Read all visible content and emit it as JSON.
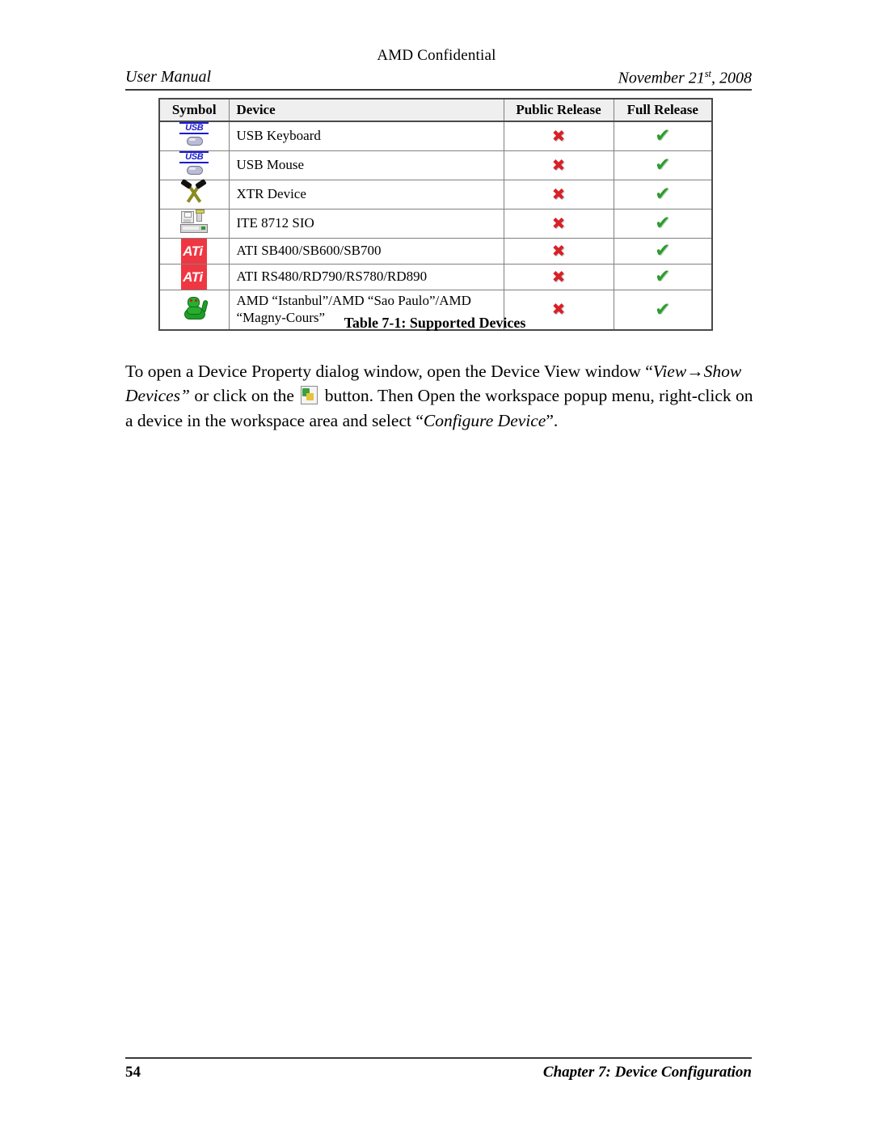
{
  "header": {
    "confidential": "AMD Confidential",
    "left": "User Manual",
    "date_prefix": "November 21",
    "date_suffix": "st",
    "date_year": ", 2008"
  },
  "table": {
    "columns": [
      "Symbol",
      "Device",
      "Public Release",
      "Full Release"
    ],
    "rows": [
      {
        "symbol": "usb-keyboard-icon",
        "device": "USB Keyboard",
        "public_release": "✖",
        "full_release": "✔"
      },
      {
        "symbol": "usb-mouse-icon",
        "device": "USB Mouse",
        "public_release": "✖",
        "full_release": "✔"
      },
      {
        "symbol": "crossed-hammers-icon",
        "device": "XTR Device",
        "public_release": "✖",
        "full_release": "✔"
      },
      {
        "symbol": "sio-chip-icon",
        "device": "ITE 8712 SIO",
        "public_release": "✖",
        "full_release": "✔"
      },
      {
        "symbol": "ati-logo-icon",
        "device": "ATI SB400/SB600/SB700",
        "public_release": "✖",
        "full_release": "✔"
      },
      {
        "symbol": "ati-logo-icon",
        "device": "ATI RS480/RD790/RS780/RD890",
        "public_release": "✖",
        "full_release": "✔"
      },
      {
        "symbol": "snake-icon",
        "device": "AMD “Istanbul”/AMD “Sao Paulo”/AMD “Magny-Cours”",
        "public_release": "✖",
        "full_release": "✔"
      }
    ],
    "ati_logo_text": "ATi",
    "usb_word": "USB",
    "caption": "Table 7-1: Supported Devices"
  },
  "body": {
    "part1": "To open a Device Property dialog window, open the Device View window “",
    "emph1": "View→Show Devices”",
    "part2": " or click on the ",
    "icon_name": "show-devices-button-icon",
    "part3": " button. Then Open the workspace popup menu, right-click on a device in the workspace area and select “",
    "emph2": "Configure Device",
    "part4": "”."
  },
  "footer": {
    "page_number": "54",
    "chapter": "Chapter 7: Device Configuration"
  },
  "colors": {
    "usb_blue": "#1a1ad0",
    "ati_red": "#ee3742",
    "check_green": "#2f9b2f",
    "cross_red": "#d92026",
    "header_fill": "#efefef"
  }
}
